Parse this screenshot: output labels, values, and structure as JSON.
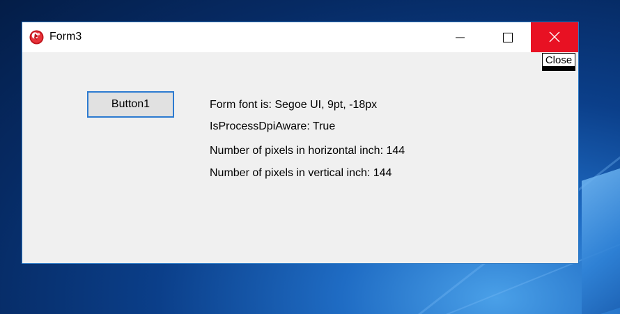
{
  "window": {
    "title": "Form3",
    "accent_color": "#e81123",
    "border_color": "#2a78c4",
    "icon": "delphi-app-icon"
  },
  "titlebar_controls": {
    "minimize_icon": "minimize-icon",
    "maximize_icon": "maximize-icon",
    "close_icon": "close-icon"
  },
  "form": {
    "close_label": "Close",
    "button1_label": "Button1",
    "lines": [
      "Form font is: Segoe UI, 9pt, -18px",
      "IsProcessDpiAware: True",
      "Number of pixels in horizontal inch: 144",
      "Number of pixels in vertical inch: 144"
    ]
  }
}
